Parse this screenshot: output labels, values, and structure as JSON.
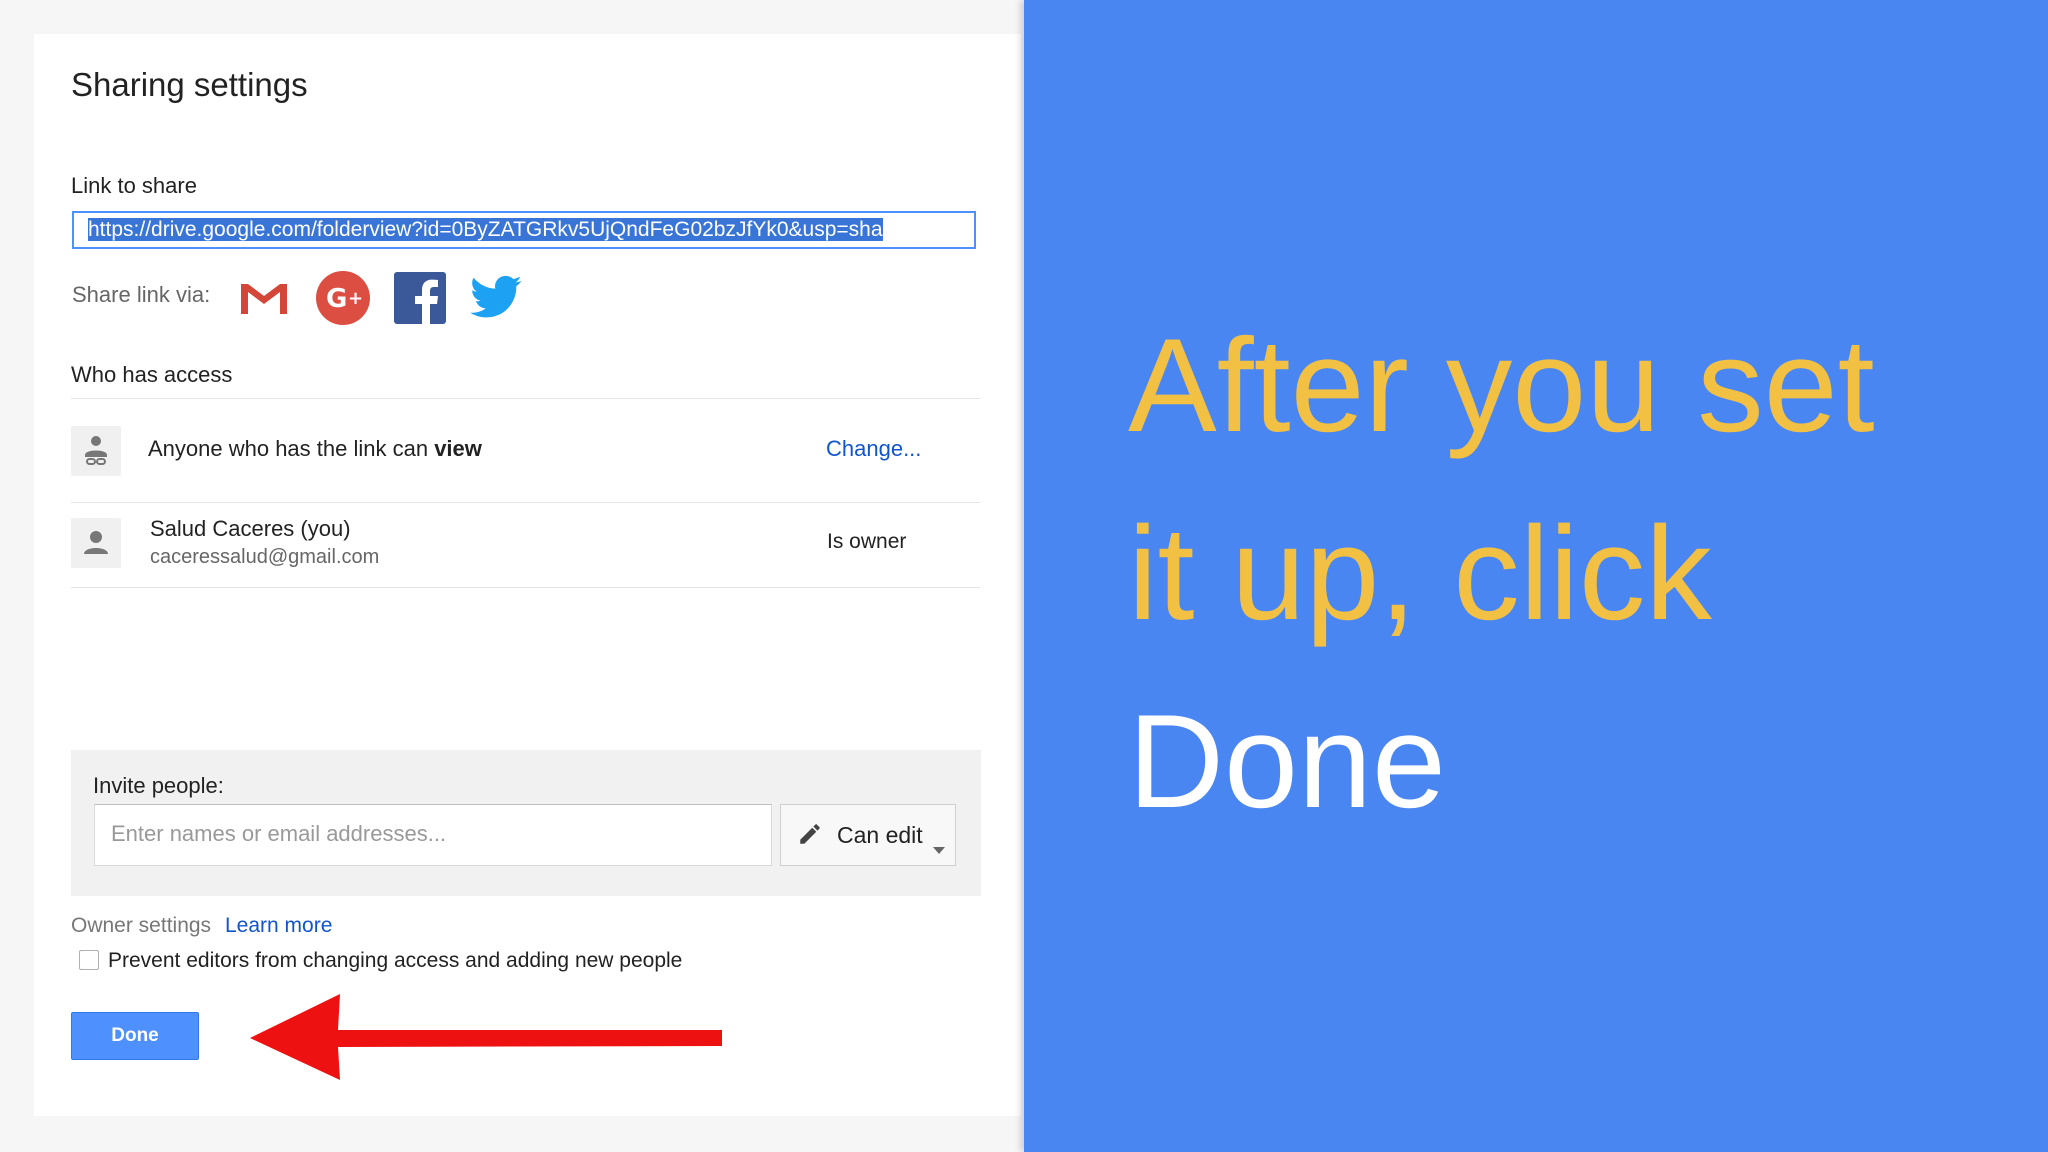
{
  "dialog": {
    "title": "Sharing settings",
    "link_label": "Link to share",
    "link_value": "https://drive.google.com/folderview?id=0ByZATGRkv5UjQndFeG02bzJfYk0&usp=sha",
    "share_via_label": "Share link via:",
    "share_icons": [
      "gmail-icon",
      "google-plus-icon",
      "facebook-icon",
      "twitter-icon"
    ],
    "who_has_access_label": "Who has access",
    "access_rows": [
      {
        "text_prefix": "Anyone who has the link can ",
        "text_bold": "view",
        "action": "Change..."
      },
      {
        "name": "Salud Caceres (you)",
        "email": "caceressalud@gmail.com",
        "role": "Is owner"
      }
    ],
    "invite": {
      "label": "Invite people:",
      "placeholder": "Enter names or email addresses...",
      "permission": "Can edit"
    },
    "owner_settings_label": "Owner settings",
    "learn_more": "Learn more",
    "prevent_label": "Prevent editors from changing access and adding new people",
    "prevent_checked": false,
    "done_label": "Done"
  },
  "caption": {
    "line1": "After you set",
    "line2": "it up, click",
    "line3": "Done"
  },
  "colors": {
    "panel_blue": "#4a86f1",
    "caption_yellow": "#f2c043",
    "caption_white": "#ffffff",
    "done_blue": "#4d90fe",
    "arrow_red": "#ee1111"
  }
}
